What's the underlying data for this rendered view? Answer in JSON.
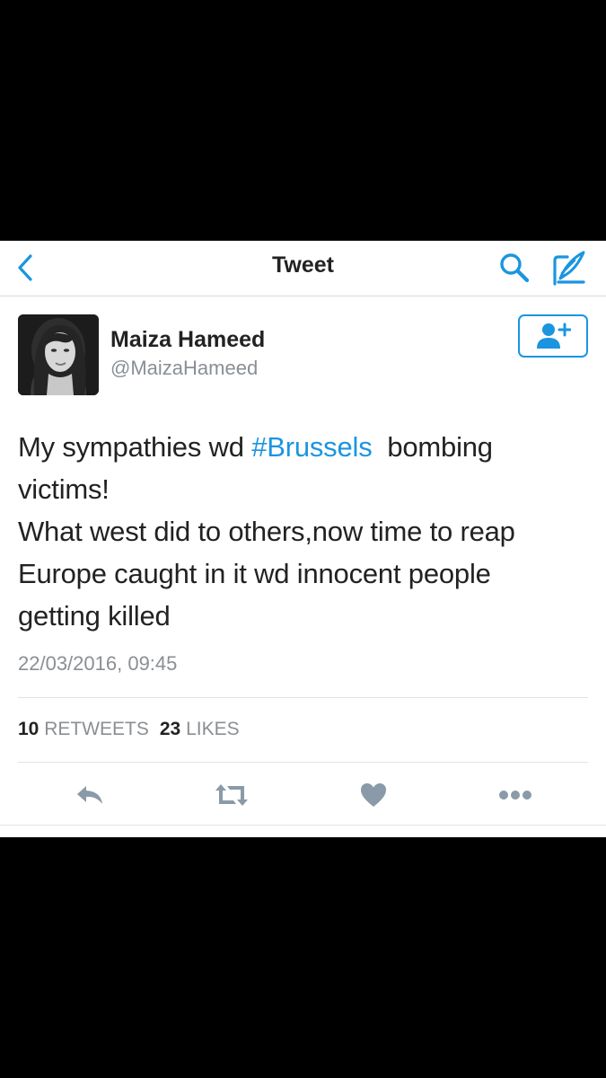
{
  "navbar": {
    "title": "Tweet",
    "back_icon": "chevron-left-icon",
    "search_icon": "search-icon",
    "compose_icon": "compose-icon",
    "accent_color": "#1b95e0"
  },
  "tweet": {
    "author": {
      "name": "Maiza Hameed",
      "handle": "@MaizaHameed"
    },
    "follow_icon": "add-user-icon",
    "text": {
      "line1_before": "My sympathies wd ",
      "hashtag": "#Brussels",
      "line1_after": "  bombing",
      "line2": "victims!",
      "line3": "What west did to others,now time to reap",
      "line4": "Europe caught in it wd innocent people",
      "line5": "getting killed"
    },
    "timestamp": "22/03/2016, 09:45",
    "stats": {
      "retweets_count": "10",
      "retweets_label": "RETWEETS",
      "likes_count": "23",
      "likes_label": "LIKES"
    },
    "actions": [
      "reply-icon",
      "retweet-icon",
      "like-icon",
      "more-icon"
    ],
    "hashtag_color": "#1b95e0",
    "action_icon_color": "#8a9aa8"
  }
}
